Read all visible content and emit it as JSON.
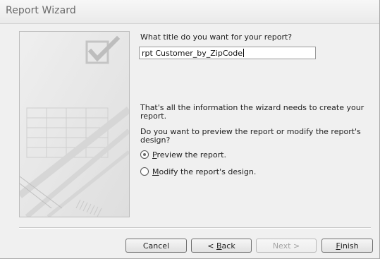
{
  "window": {
    "title": "Report Wizard"
  },
  "question": {
    "label": "What title do you want for your report?",
    "value": "rpt Customer_by_ZipCode"
  },
  "info": {
    "line1": "That's all the information the wizard needs to create your report.",
    "line2": "Do you want to preview the report or modify the report's design?"
  },
  "options": [
    {
      "accel": "P",
      "rest": "review the report.",
      "checked": true
    },
    {
      "accel": "M",
      "rest": "odify the report's design.",
      "checked": false
    }
  ],
  "buttons": {
    "cancel": "Cancel",
    "back_prefix": "< ",
    "back_accel": "B",
    "back_rest": "ack",
    "next": "Next >",
    "finish_accel": "F",
    "finish_rest": "inish"
  }
}
